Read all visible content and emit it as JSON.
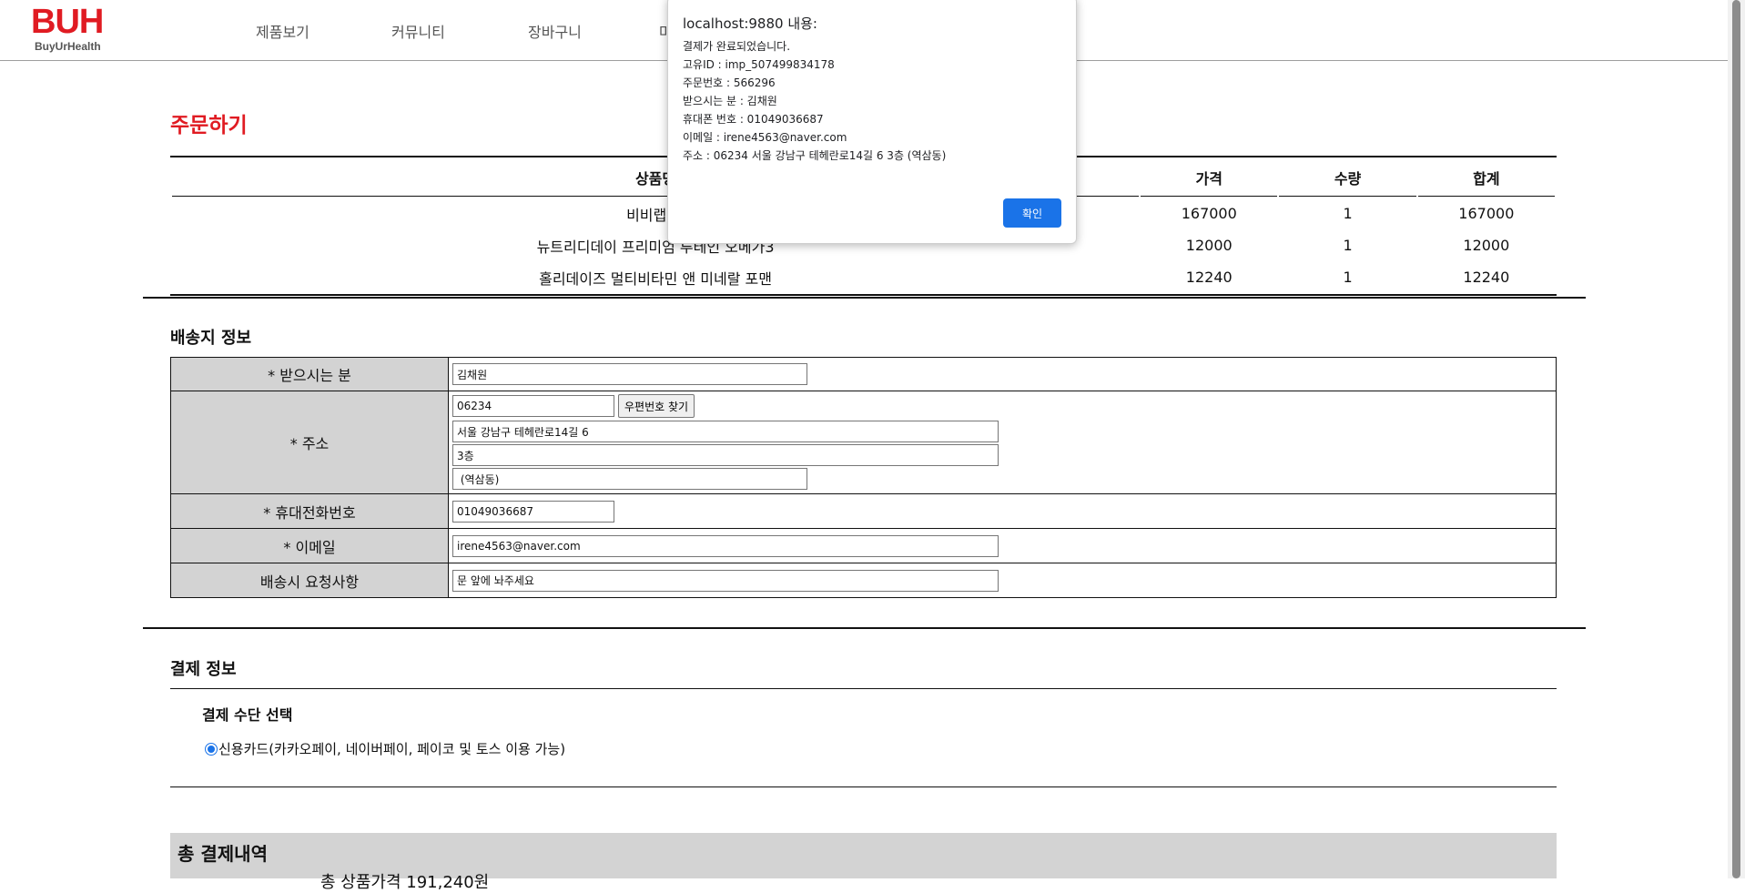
{
  "header": {
    "logo_mark": "BUH",
    "logo_sub": "BuyUrHealth",
    "nav": [
      "제품보기",
      "커뮤니티",
      "장바구니",
      "마"
    ]
  },
  "order": {
    "title": "주문하기",
    "columns": [
      "상품명",
      "가격",
      "수량",
      "합계"
    ],
    "rows": [
      {
        "name": "비비랩 콜",
        "price": "167000",
        "qty": "1",
        "total": "167000"
      },
      {
        "name": "뉴트리디데이 프리미엄 루테인 오메가3",
        "price": "12000",
        "qty": "1",
        "total": "12000"
      },
      {
        "name": "홀리데이즈 멀티비타민 앤 미네랄 포맨",
        "price": "12240",
        "qty": "1",
        "total": "12240"
      }
    ]
  },
  "shipping": {
    "title": "배송지 정보",
    "recipient_label": "* 받으시는 분",
    "recipient_value": "김채원",
    "address_label": "* 주소",
    "zipcode_value": "06234",
    "zip_button": "우편번호 찾기",
    "address1_value": "서울 강남구 테헤란로14길 6",
    "address2_value": "3층",
    "address3_value": " (역삼동)",
    "phone_label": "* 휴대전화번호",
    "phone_value": "01049036687",
    "email_label": "* 이메일",
    "email_value": "irene4563@naver.com",
    "request_label": "배송시 요청사항",
    "request_value": "문 앞에 놔주세요"
  },
  "payment": {
    "title": "결제 정보",
    "method_title": "결제 수단 선택",
    "method_option": "신용카드(카카오페이, 네이버페이, 페이코 및 토스 이용 가능)"
  },
  "total": {
    "title": "총 결제내역",
    "product_price": "총 상품가격 191,240원"
  },
  "dialog": {
    "title": "localhost:9880 내용:",
    "lines": [
      "결제가 완료되었습니다.",
      "고유ID : imp_507499834178",
      "주문번호 : 566296",
      "받으시는 분 : 김채원",
      "휴대폰 번호 : 01049036687",
      "이메일 : irene4563@naver.com",
      "주소 : 06234 서울 강남구 테헤란로14길 6 3층  (역삼동)"
    ],
    "ok_label": "확인",
    "accent": "#1a73e8"
  },
  "colors": {
    "brand": "#e01b22",
    "label_bg": "#d3d3d3"
  }
}
